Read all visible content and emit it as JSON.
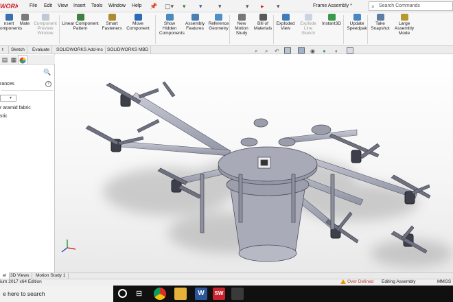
{
  "app": {
    "logo": "WORKS",
    "document_title": "Frame Assembly *",
    "menus": [
      "File",
      "Edit",
      "View",
      "Insert",
      "Tools",
      "Window",
      "Help"
    ],
    "search_placeholder": "Search Commands"
  },
  "quick_access": {
    "pin": "📌",
    "new": "▢▾",
    "open": "▾",
    "save": "▾",
    "print": "▾",
    "select": "▾",
    "rebuild": "▸",
    "options": "▾"
  },
  "ribbon": {
    "buttons": [
      {
        "label": "nsert\nomponents",
        "enabled": true,
        "color": "#3b6fb0"
      },
      {
        "label": "Mate",
        "enabled": true,
        "color": "#7a7a7a"
      },
      {
        "label": "Component\nPreview\nWindow",
        "enabled": false,
        "color": "#6d86a8"
      },
      {
        "label": "Linear Component\nPattern",
        "enabled": true,
        "color": "#3f7f3f"
      },
      {
        "label": "Smart\nFasteners",
        "enabled": true,
        "color": "#b08a2e"
      },
      {
        "label": "Move\nComponent",
        "enabled": true,
        "color": "#2d6bb8"
      },
      {
        "label": "Show\nHidden\nComponents",
        "enabled": true,
        "color": "#4a8ac0"
      },
      {
        "label": "Assembly\nFeatures",
        "enabled": true,
        "color": "#4a7fb5"
      },
      {
        "label": "Reference\nGeometry",
        "enabled": true,
        "color": "#4f8fc7"
      },
      {
        "label": "New\nMotion\nStudy",
        "enabled": true,
        "color": "#777777"
      },
      {
        "label": "Bill of\nMaterials",
        "enabled": true,
        "color": "#5a5a5a"
      },
      {
        "label": "Exploded\nView",
        "enabled": true,
        "color": "#3d7dbb"
      },
      {
        "label": "Explode\nLine\nSketch",
        "enabled": false,
        "color": "#8aa2c0"
      },
      {
        "label": "Instant3D",
        "enabled": true,
        "color": "#3b9a4a"
      },
      {
        "label": "Update\nSpeedpak",
        "enabled": true,
        "color": "#4a86c4"
      },
      {
        "label": "Take\nSnapshot",
        "enabled": true,
        "color": "#5c7ea3"
      },
      {
        "label": "Large\nAssembly\nMode",
        "enabled": true,
        "color": "#b59a2f"
      }
    ]
  },
  "command_tabs": [
    "t",
    "Sketch",
    "Evaluate",
    "SOLIDWORKS Add-Ins",
    "SOLIDWORKS MBD"
  ],
  "left_panel": {
    "tab_icons": [
      "appearance-icon"
    ],
    "search_icon": "🔍",
    "header": "rances",
    "help": "?",
    "items": [
      "r aramid fabric",
      "stic"
    ]
  },
  "bottom_tabs": [
    "el",
    "3D Views",
    "Motion Study 1"
  ],
  "status": {
    "edition": "ium 2017 x64 Edition",
    "over_defined": "Over Defined",
    "editing": "Editing Assembly",
    "units": "MMGS",
    "over_defined_color": "#c0392b"
  },
  "taskbar": {
    "search_text": "e here to search"
  }
}
